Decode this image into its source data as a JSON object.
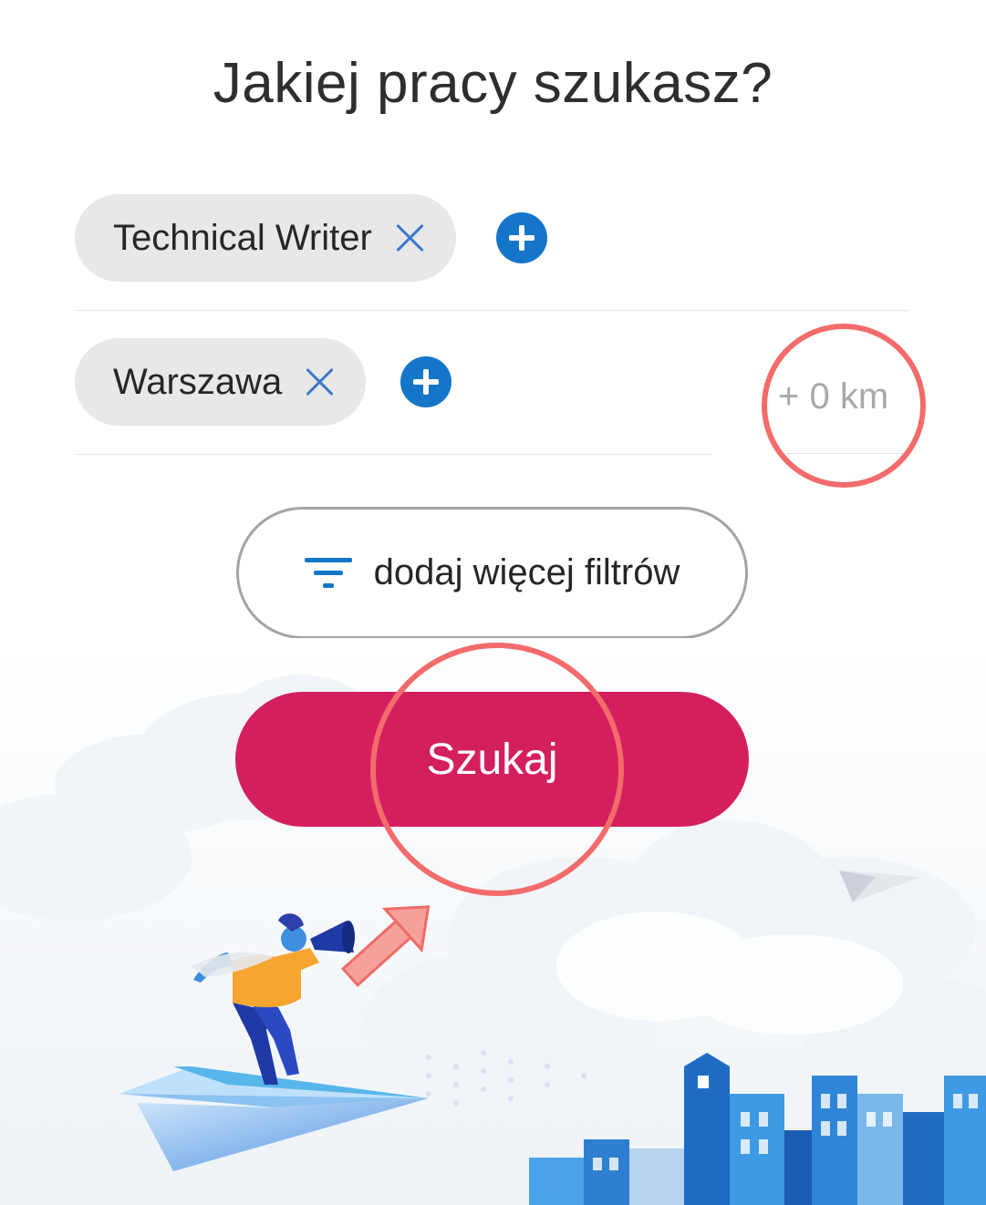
{
  "header": {
    "title": "Jakiej pracy szukasz?"
  },
  "position": {
    "chips": [
      {
        "label": "Technical Writer"
      }
    ]
  },
  "location": {
    "chips": [
      {
        "label": "Warszawa"
      }
    ],
    "radius_label": "+ 0 km"
  },
  "filters": {
    "label": "dodaj więcej filtrów"
  },
  "search": {
    "label": "Szukaj"
  },
  "colors": {
    "accent_blue": "#1576c9",
    "search_button": "#d41f5e",
    "chip_bg": "#e8e8e8",
    "highlight_circle": "#f36b6b"
  },
  "icons": {
    "remove_chip": "close-icon",
    "add": "plus-circle-icon",
    "filters": "filter-icon"
  }
}
